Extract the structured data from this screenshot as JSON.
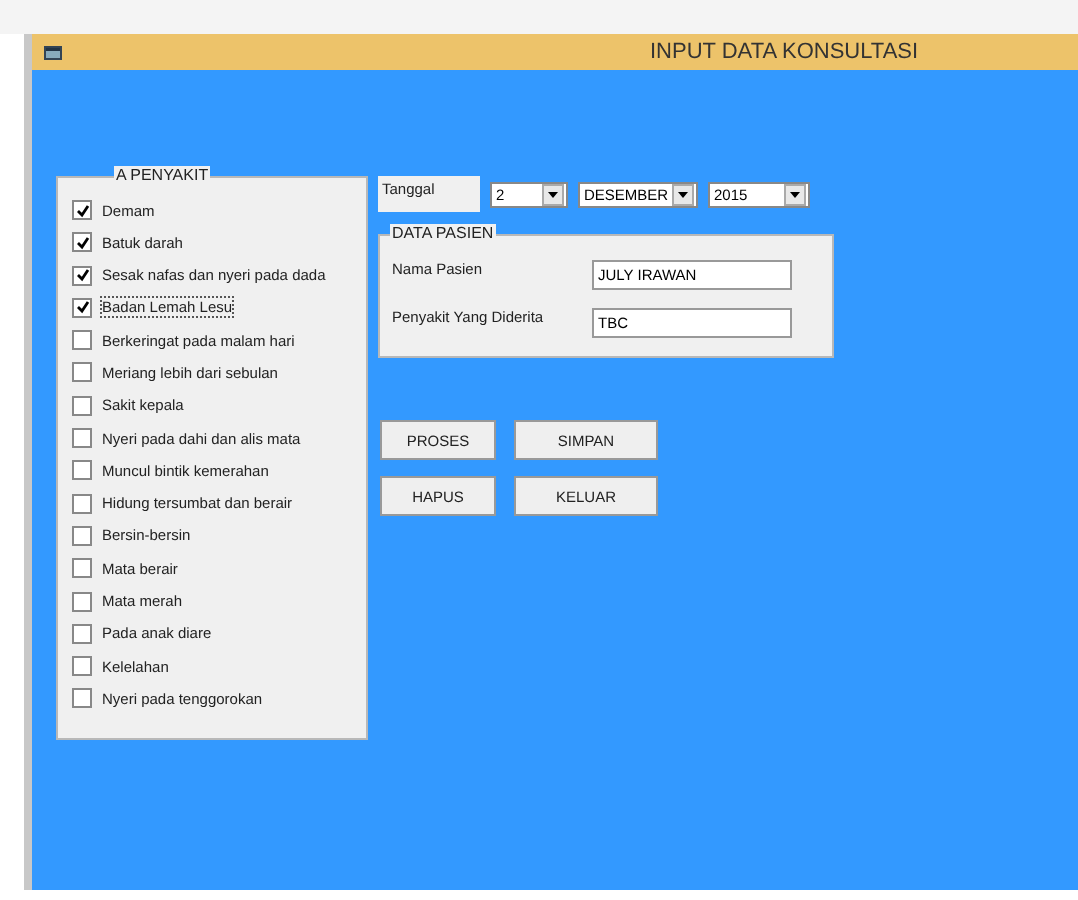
{
  "window": {
    "title": "INPUT DATA  KONSULTASI"
  },
  "penyakit": {
    "title": "A PENYAKIT",
    "items": [
      {
        "label": "Demam",
        "checked": true,
        "focused": false
      },
      {
        "label": "Batuk darah",
        "checked": true,
        "focused": false
      },
      {
        "label": "Sesak nafas dan nyeri pada dada",
        "checked": true,
        "focused": false
      },
      {
        "label": "Badan Lemah Lesu",
        "checked": true,
        "focused": true
      },
      {
        "label": "Berkeringat pada malam hari",
        "checked": false,
        "focused": false
      },
      {
        "label": "Meriang lebih dari sebulan",
        "checked": false,
        "focused": false
      },
      {
        "label": "Sakit kepala",
        "checked": false,
        "focused": false
      },
      {
        "label": "Nyeri pada dahi dan alis mata",
        "checked": false,
        "focused": false
      },
      {
        "label": "Muncul bintik kemerahan",
        "checked": false,
        "focused": false
      },
      {
        "label": "Hidung tersumbat dan berair",
        "checked": false,
        "focused": false
      },
      {
        "label": "Bersin-bersin",
        "checked": false,
        "focused": false
      },
      {
        "label": "Mata berair",
        "checked": false,
        "focused": false
      },
      {
        "label": "Mata merah",
        "checked": false,
        "focused": false
      },
      {
        "label": "Pada anak diare",
        "checked": false,
        "focused": false
      },
      {
        "label": "Kelelahan",
        "checked": false,
        "focused": false
      },
      {
        "label": "Nyeri pada tenggorokan",
        "checked": false,
        "focused": false
      }
    ]
  },
  "tanggal": {
    "label": "Tanggal",
    "day": "2",
    "month": "DESEMBER",
    "year": "2015"
  },
  "data_pasien": {
    "title": "DATA PASIEN",
    "fields": [
      {
        "label": "Nama Pasien",
        "value": "JULY IRAWAN"
      },
      {
        "label": "Penyakit Yang Diderita",
        "value": "TBC"
      }
    ]
  },
  "buttons": [
    [
      "PROSES",
      "SIMPAN"
    ],
    [
      "HAPUS",
      "KELUAR"
    ]
  ]
}
